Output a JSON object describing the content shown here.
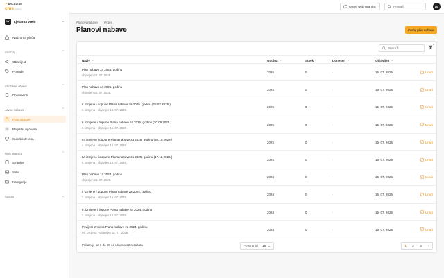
{
  "brand": {
    "top": "ARCADIAN",
    "cms": "cms",
    "cms_suffix": "sidebar"
  },
  "tenant": {
    "initials": "LV",
    "name": "Ljekarna Vrelo"
  },
  "sidebar": {
    "home": "Nadzorna ploča",
    "sections": [
      {
        "label": "Sadržaj",
        "items": [
          "Obavijesti",
          "Ponude"
        ]
      },
      {
        "label": "Službene objave",
        "items": [
          "Dokumenti"
        ]
      },
      {
        "label": "Javna nabava",
        "items": [
          "Plan nabave",
          "Registar ugovora",
          "Sukob interesa"
        ]
      },
      {
        "label": "Web stranica",
        "items": [
          "Stranice",
          "Slike",
          "Kategorije"
        ]
      },
      {
        "label": "Sustav",
        "items": []
      }
    ]
  },
  "topbar": {
    "web_button": "Otvori web stranicu",
    "search_placeholder": "Pretraži",
    "avatar": "AM"
  },
  "breadcrumb": {
    "root": "Planovi nabave",
    "sep": "›",
    "current": "Popis"
  },
  "page": {
    "title": "Planovi nabave",
    "add_button": "Dodaj plan nabave"
  },
  "table": {
    "search_placeholder": "Pretraži",
    "filter_count": "0",
    "columns": {
      "name": "Naziv",
      "year": "Godina",
      "items": "Stavki",
      "adopted": "Donesen",
      "published": "Objavljen"
    },
    "edit_label": "Uredi",
    "rows": [
      {
        "title": "Plan nabave za 2026. godinu",
        "sub": "objavljen 15. 07. 2026.",
        "year": "2026",
        "items": "0",
        "adopted": "-",
        "published": "15. 07. 2026."
      },
      {
        "title": "Plan nabave za 2025. godinu",
        "sub": "objavljen 15. 07. 2026.",
        "year": "2025",
        "items": "0",
        "adopted": "-",
        "published": "15. 07. 2026."
      },
      {
        "title": "I. izmjene i dopune Plana nabave za 2025. godinu (25.02.2025.)",
        "sub": "2. izmjena · objavljen 15. 07. 2026.",
        "year": "2025",
        "items": "0",
        "adopted": "-",
        "published": "15. 07. 2026."
      },
      {
        "title": "II. izmjene i dopune Plana nabave za 2025. godinu (30.09.2025.)",
        "sub": "3. izmjena · objavljen 15. 07. 2026.",
        "year": "2025",
        "items": "0",
        "adopted": "-",
        "published": "15. 07. 2026."
      },
      {
        "title": "III. izmjene i dopune Plana nabave za 2025. godinu (30.10.2025.)",
        "sub": "4. izmjena · objavljen 15. 07. 2026.",
        "year": "2025",
        "items": "0",
        "adopted": "-",
        "published": "15. 07. 2026."
      },
      {
        "title": "IV. izmjene i dopune Plana nabave za 2025. godinu (17.12.2025.)",
        "sub": "5. izmjena · objavljen 15. 07. 2026.",
        "year": "2025",
        "items": "0",
        "adopted": "-",
        "published": "15. 07. 2026."
      },
      {
        "title": "Plan nabave za 2024. godinu",
        "sub": "objavljen 15. 07. 2026.",
        "year": "2024",
        "items": "0",
        "adopted": "-",
        "published": "15. 07. 2026."
      },
      {
        "title": "I. izmjene i dopune Plana nabave za 2024. godinu",
        "sub": "2. izmjena · objavljen 15. 07. 2026.",
        "year": "2024",
        "items": "0",
        "adopted": "-",
        "published": "15. 07. 2026."
      },
      {
        "title": "II. izmjene i dopune Plana nabave za 2024. godinu",
        "sub": "3. izmjena · objavljen 15. 07. 2026.",
        "year": "2024",
        "items": "0",
        "adopted": "-",
        "published": "15. 07. 2026."
      },
      {
        "title": "Povijest izmjena Plana nabave za 2024. godinu",
        "sub": "98. izmjena · objavljen 15. 07. 2026.",
        "year": "2024",
        "items": "0",
        "adopted": "-",
        "published": "15. 07. 2026."
      }
    ]
  },
  "footer": {
    "info": "Prikazuje se 1 do 10 od ukupno 22 rezultata",
    "per_page_label": "Po stranici",
    "per_page_value": "10",
    "pages": [
      "1",
      "2",
      "3"
    ],
    "current_page": "1"
  },
  "colors": {
    "accent": "#f5a623",
    "accent_text": "#e08a10",
    "active_bg": "#fdf2e3"
  }
}
